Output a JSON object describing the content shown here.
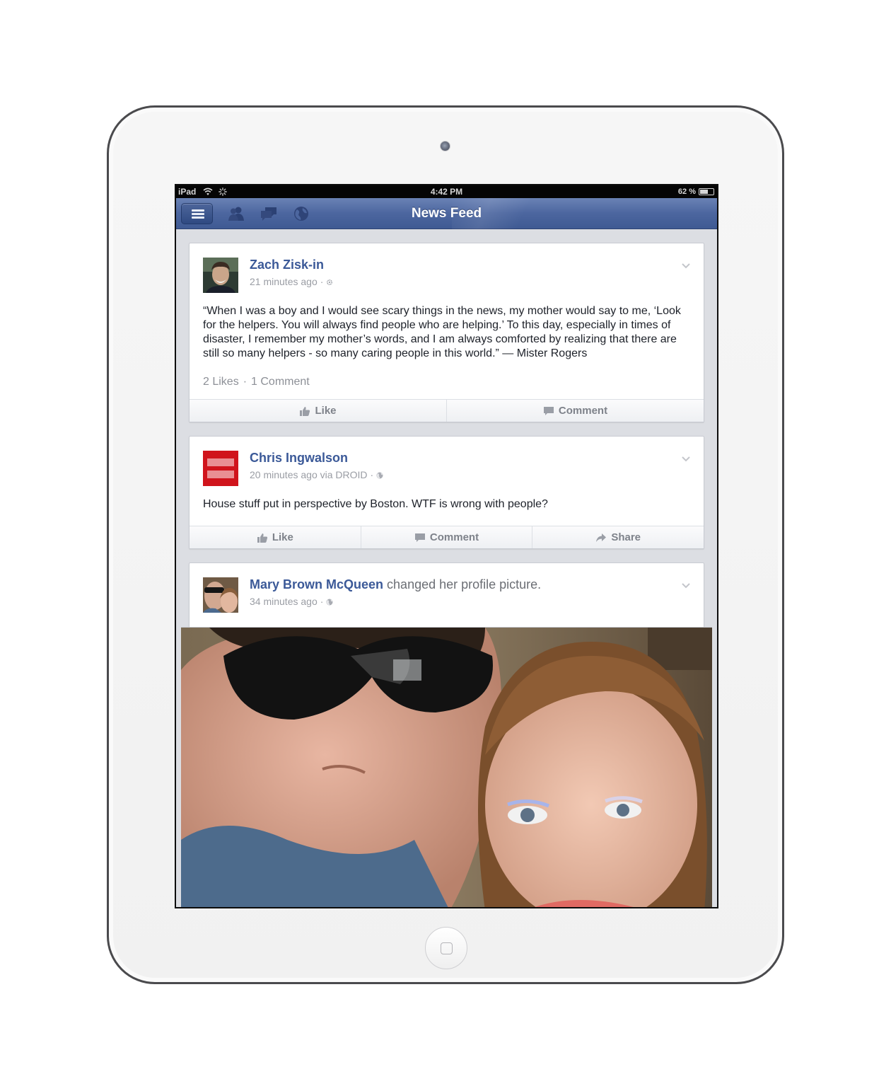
{
  "status_bar": {
    "device": "iPad",
    "time": "4:42 PM",
    "battery": "62 %",
    "battery_level": 0.62
  },
  "nav_bar": {
    "title": "News Feed",
    "icons": [
      "menu-icon",
      "friend-requests-icon",
      "messages-icon",
      "notifications-globe-icon"
    ]
  },
  "posts": [
    {
      "author": "Zach Zisk-in",
      "time": "21 minutes ago",
      "privacy_icon": "gear-icon",
      "text": "“When I was a boy and I would see scary things in the news, my mother would say to me, ‘Look for the helpers. You will always find people who are helping.’ To this day, especially in times of disaster, I remember my mother’s words, and I am always comforted by realizing that there are still so many helpers - so many caring people in this world.” — Mister Rogers",
      "likes": "2 Likes",
      "comments": "1 Comment",
      "actions": [
        "Like",
        "Comment"
      ]
    },
    {
      "author": "Chris Ingwalson",
      "time": "20 minutes ago via DROID",
      "privacy_icon": "globe-icon",
      "text": "House stuff put in perspective by Boston. WTF is wrong with people?",
      "actions": [
        "Like",
        "Comment",
        "Share"
      ]
    },
    {
      "author": "Mary Brown McQueen",
      "action_text": " changed her profile picture.",
      "time": "34 minutes ago",
      "privacy_icon": "globe-icon"
    }
  ],
  "colors": {
    "brand_blue": "#3b5998",
    "nav_bar": "#4c669f",
    "feed_background": "#dcdee3",
    "equality_red": "#d0141c"
  }
}
